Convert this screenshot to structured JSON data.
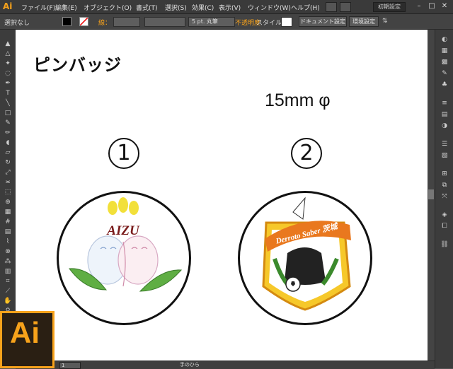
{
  "app": {
    "logo": "Ai",
    "menus": [
      "ファイル(F)",
      "編集(E)",
      "オブジェクト(O)",
      "書式(T)",
      "選択(S)",
      "効果(C)",
      "表示(V)",
      "ウィンドウ(W)",
      "ヘルプ(H)"
    ],
    "workspace": "初期設定"
  },
  "controlbar": {
    "selection": "選択なし",
    "stroke_label": "線：",
    "stroke_profile": "5 pt. 丸筆",
    "opacity_label": "不透明度",
    "style_label": "スタイル：",
    "doc_settings": "ドキュメント設定",
    "env_settings": "環境設定"
  },
  "artboard": {
    "title": "ピンバッジ",
    "size": "15mm φ",
    "badge1_number": "①",
    "badge2_number": "②",
    "badge1_text": "AIZU",
    "badge2_text": "Derroto Saber 茨城"
  },
  "status": {
    "zoom": "1",
    "tool": "手のひら"
  },
  "colors": {
    "accent_orange": "#f7a21b",
    "opacity_orange": "#f7a21b"
  }
}
